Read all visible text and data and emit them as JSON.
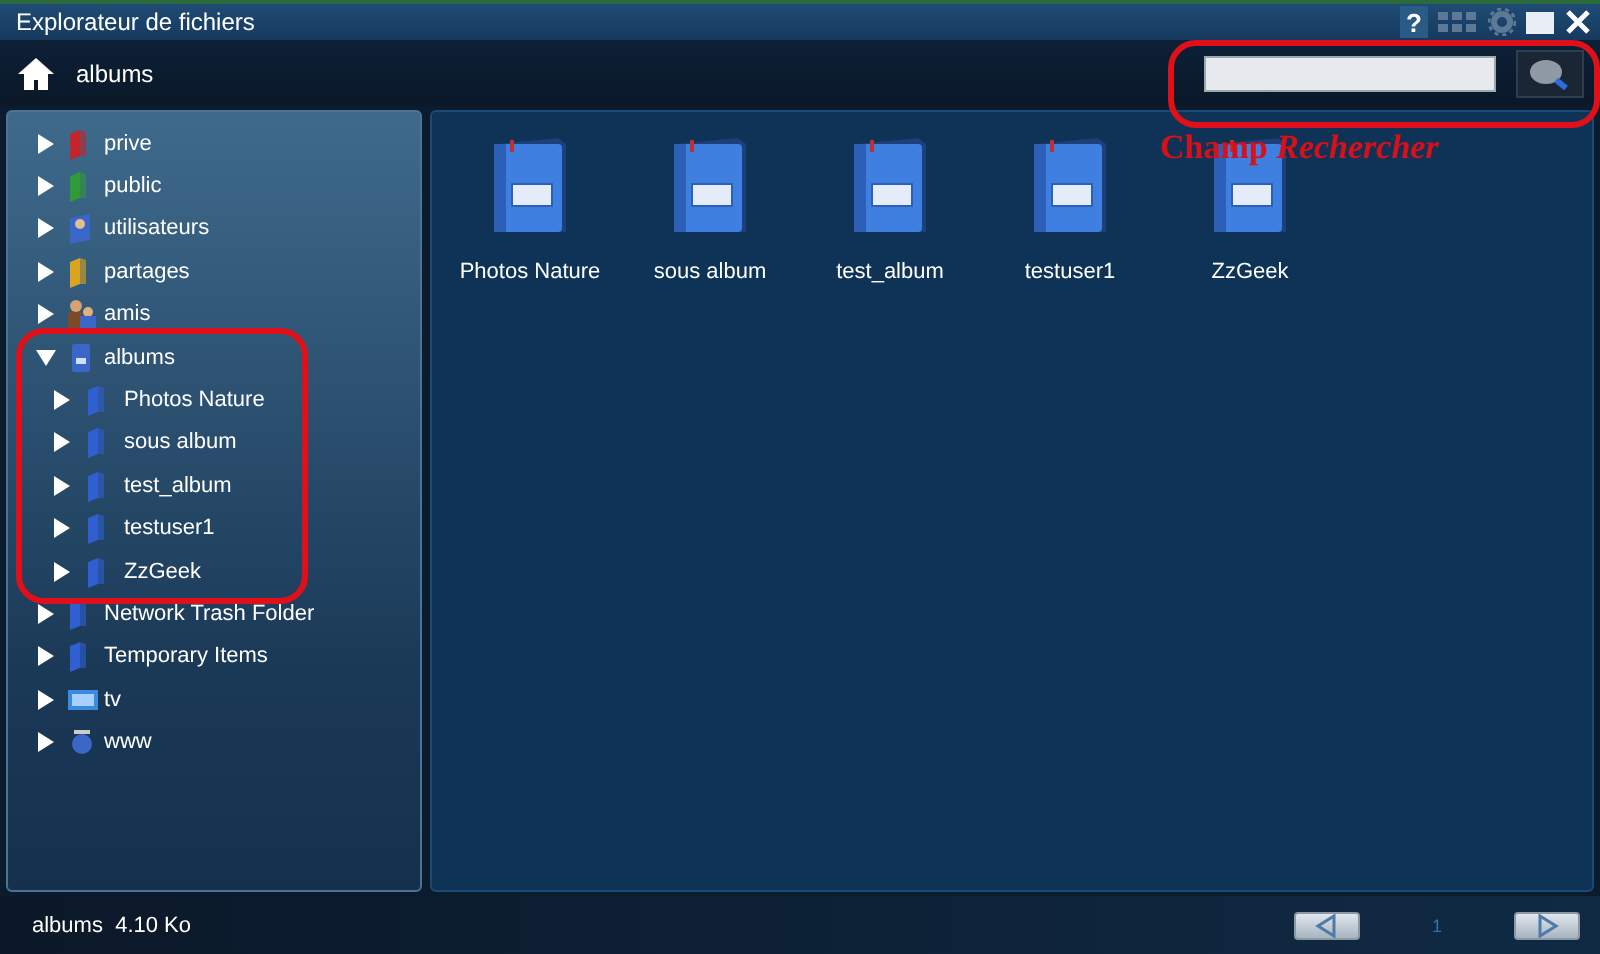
{
  "window": {
    "title": "Explorateur de fichiers",
    "help": "?"
  },
  "toolbar": {
    "path": "albums"
  },
  "sidebar": {
    "items": [
      {
        "label": "prive",
        "kind": "folder",
        "color": "#c0262b",
        "expanded": false
      },
      {
        "label": "public",
        "kind": "folder",
        "color": "#2f9a3a",
        "expanded": false
      },
      {
        "label": "utilisateurs",
        "kind": "user-folder",
        "color": "#3a66c8",
        "expanded": false
      },
      {
        "label": "partages",
        "kind": "folder",
        "color": "#d9a521",
        "expanded": false
      },
      {
        "label": "amis",
        "kind": "group",
        "color": "#3a66c8",
        "expanded": false
      },
      {
        "label": "albums",
        "kind": "album",
        "color": "#3a66c8",
        "expanded": true,
        "children": [
          {
            "label": "Photos Nature",
            "kind": "folder",
            "color": "#2f5fd0",
            "expanded": false
          },
          {
            "label": "sous album",
            "kind": "folder",
            "color": "#2f5fd0",
            "expanded": false
          },
          {
            "label": "test_album",
            "kind": "folder",
            "color": "#2f5fd0",
            "expanded": false
          },
          {
            "label": "testuser1",
            "kind": "folder",
            "color": "#2f5fd0",
            "expanded": false
          },
          {
            "label": "ZzGeek",
            "kind": "folder",
            "color": "#2f5fd0",
            "expanded": false
          }
        ]
      },
      {
        "label": "Network Trash Folder",
        "kind": "folder",
        "color": "#2f5fd0",
        "expanded": false
      },
      {
        "label": "Temporary Items",
        "kind": "folder",
        "color": "#2f5fd0",
        "expanded": false
      },
      {
        "label": "tv",
        "kind": "screen",
        "color": "#3a8ae0",
        "expanded": false
      },
      {
        "label": "www",
        "kind": "globe",
        "color": "#3a66c8",
        "expanded": false
      }
    ]
  },
  "content": {
    "items": [
      {
        "label": "Photos Nature"
      },
      {
        "label": "sous album"
      },
      {
        "label": "test_album"
      },
      {
        "label": "testuser1"
      },
      {
        "label": "ZzGeek"
      }
    ]
  },
  "status_bar": {
    "text": "albums  4.10 Ko",
    "page": "1"
  },
  "annotations": [
    {
      "kind": "callout",
      "label": "Champ *Rechercher*"
    }
  ]
}
